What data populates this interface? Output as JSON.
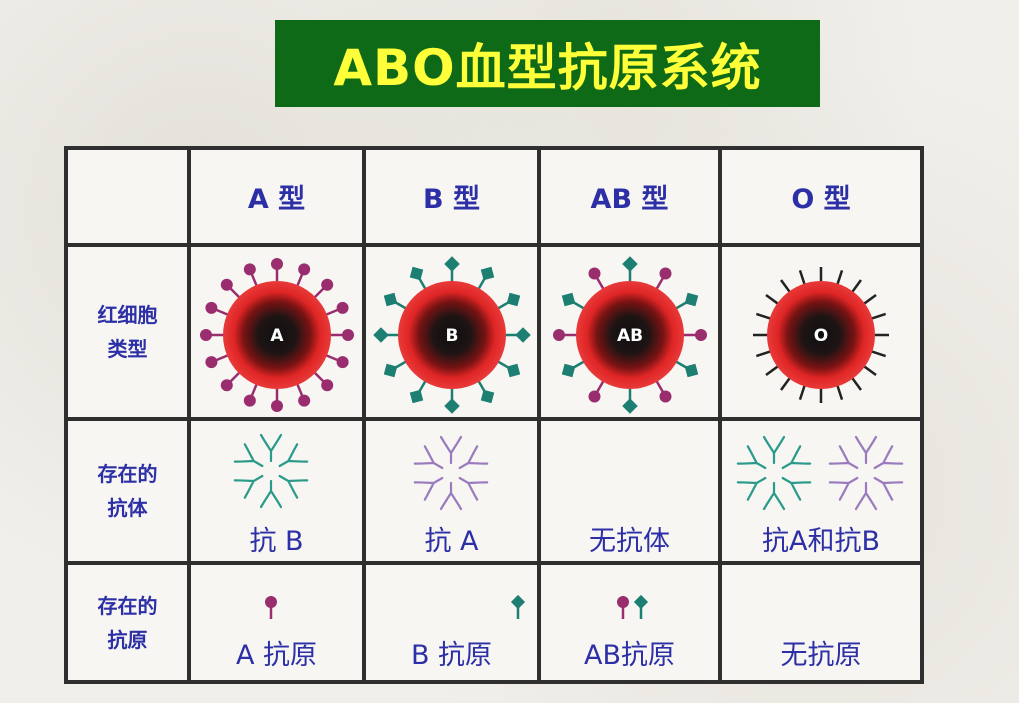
{
  "title": "ABO血型抗原系统",
  "columns": [
    "A 型",
    "B 型",
    "AB 型",
    "O 型"
  ],
  "rows": {
    "rbc": [
      "红细胞",
      "类型"
    ],
    "antibody": [
      "存在的",
      "抗体"
    ],
    "antigen": [
      "存在的",
      "抗原"
    ]
  },
  "cells": {
    "A": {
      "rbc_label": "A",
      "antibody": "抗 B",
      "antigen": "A 抗原"
    },
    "B": {
      "rbc_label": "B",
      "antibody": "抗 A",
      "antigen": "B 抗原"
    },
    "AB": {
      "rbc_label": "AB",
      "antibody": "无抗体",
      "antigen": "AB抗原"
    },
    "O": {
      "rbc_label": "O",
      "antibody": "抗A和抗B",
      "antigen": "无抗原"
    }
  },
  "colors": {
    "title_bg": "#0e6a16",
    "title_text": "#ffff3a",
    "label_text": "#2c2fa6",
    "antigen_a": "#9a2d6e",
    "antigen_b": "#1d7f72",
    "antibody_anti_b": "#2a9a8a",
    "antibody_anti_a": "#9a7bbf",
    "cell_red": "#e02525"
  }
}
